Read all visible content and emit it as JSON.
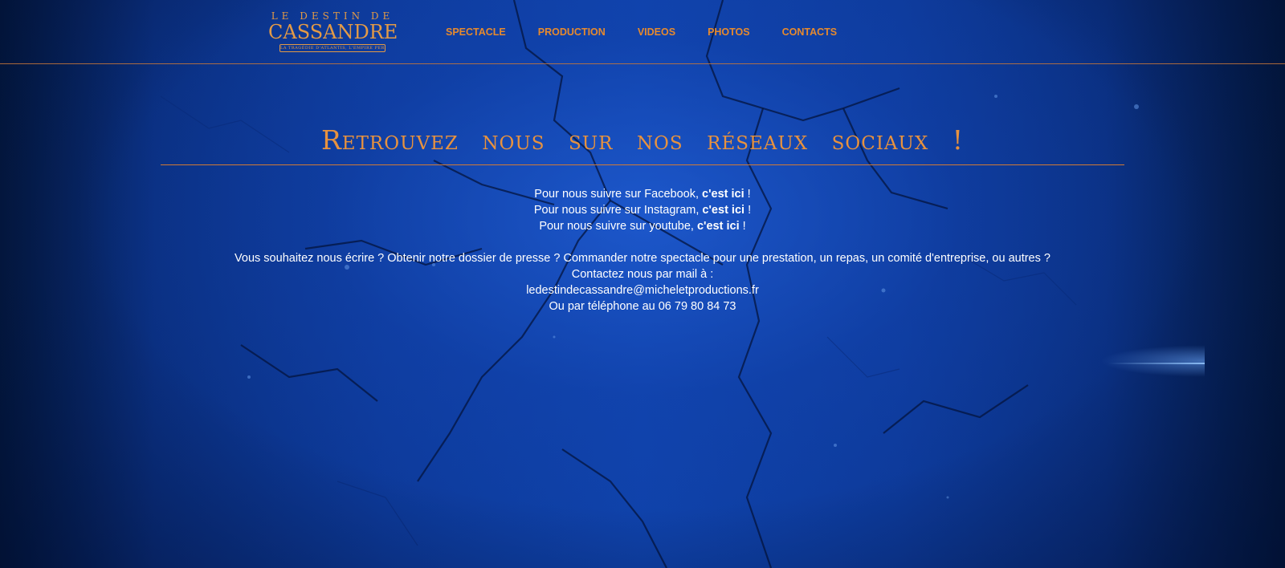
{
  "logo": {
    "top_text": "LE DESTIN DE",
    "main_text": "CASSANDRE",
    "banner_text": "LA TRAGÉDIE D'ATLANTIS, L'EMPIRE PERDU"
  },
  "nav": {
    "items": [
      {
        "label": "SPECTACLE"
      },
      {
        "label": "PRODUCTION"
      },
      {
        "label": "VIDEOS"
      },
      {
        "label": "PHOTOS"
      },
      {
        "label": "CONTACTS"
      }
    ]
  },
  "colors": {
    "accent": "#e78a2d",
    "background": "#0d3a9a",
    "text": "#ffffff"
  },
  "main": {
    "title": "Retrouvez nous sur nos réseaux sociaux !",
    "social": [
      {
        "prefix": "Pour nous suivre sur Facebook, ",
        "link": "c'est ici",
        "suffix": " !"
      },
      {
        "prefix": "Pour nous suivre sur Instagram, ",
        "link": "c'est ici",
        "suffix": " !"
      },
      {
        "prefix": "Pour nous suivre sur youtube, ",
        "link": "c'est ici",
        "suffix": " !"
      }
    ],
    "contact": {
      "intro": "Vous souhaitez nous écrire ? Obtenir notre dossier de presse ? Commander notre spectacle pour une prestation, un repas, un comité d'entreprise, ou autres ?",
      "mail_label": "Contactez nous par mail à :",
      "email": "ledestindecassandre@micheletproductions.fr",
      "phone": "Ou par téléphone au 06 79 80 84 73"
    }
  }
}
